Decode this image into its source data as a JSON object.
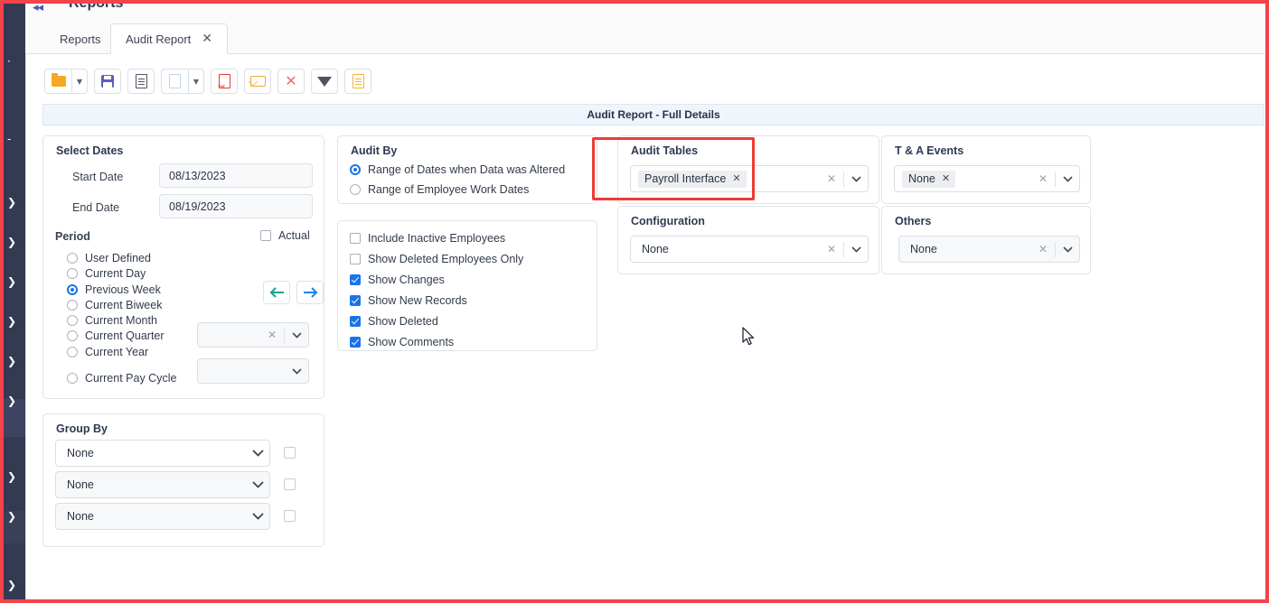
{
  "window": {
    "page_title": "Reports",
    "collapse_icon": "◂◂"
  },
  "tabs": [
    {
      "label": "Reports",
      "active": false
    },
    {
      "label": "Audit Report",
      "active": true,
      "close_icon": "✕"
    }
  ],
  "toolbar": {
    "buttons": [
      {
        "name": "open-folder-button",
        "icon": "folder-icon"
      },
      {
        "name": "open-folder-dropdown",
        "icon": "chevron-down-icon"
      },
      {
        "name": "save-button",
        "icon": "save-icon"
      },
      {
        "name": "report-document-button",
        "icon": "document-icon"
      },
      {
        "name": "new-document-button",
        "icon": "blank-document-icon"
      },
      {
        "name": "new-document-dropdown",
        "icon": "chevron-down-icon"
      },
      {
        "name": "export-pdf-button",
        "icon": "pdf-icon"
      },
      {
        "name": "email-button",
        "icon": "envelope-icon"
      },
      {
        "name": "delete-button",
        "icon": "close-x-icon"
      },
      {
        "name": "filter-button",
        "icon": "funnel-icon"
      },
      {
        "name": "export-document-button",
        "icon": "gold-document-icon"
      }
    ]
  },
  "report_header": {
    "title": "Audit Report - Full Details"
  },
  "select_dates": {
    "title": "Select Dates",
    "start_date_label": "Start Date",
    "start_date_value": "08/13/2023",
    "end_date_label": "End Date",
    "end_date_value": "08/19/2023",
    "period_label": "Period",
    "actual_label": "Actual",
    "actual_checked": false,
    "periods": [
      {
        "label": "User Defined",
        "selected": false
      },
      {
        "label": "Current Day",
        "selected": false
      },
      {
        "label": "Previous Week",
        "selected": true
      },
      {
        "label": "Current Biweek",
        "selected": false
      },
      {
        "label": "Current Month",
        "selected": false
      },
      {
        "label": "Current Quarter",
        "selected": false
      },
      {
        "label": "Current Year",
        "selected": false
      },
      {
        "label": "Current Pay Cycle",
        "selected": false
      }
    ],
    "prev_arrow": "←",
    "next_arrow": "→",
    "quarter_select_value": "",
    "pay_cycle_select_value": ""
  },
  "group_by": {
    "title": "Group By",
    "rows": [
      {
        "value": "None",
        "checked": false
      },
      {
        "value": "None",
        "checked": false
      },
      {
        "value": "None",
        "checked": false
      }
    ]
  },
  "audit_by": {
    "title": "Audit By",
    "options": [
      {
        "label": "Range of Dates when Data was Altered",
        "selected": true
      },
      {
        "label": "Range of Employee Work Dates",
        "selected": false
      }
    ]
  },
  "options": {
    "checkboxes": [
      {
        "label": "Include Inactive Employees",
        "checked": false
      },
      {
        "label": "Show Deleted Employees Only",
        "checked": false
      },
      {
        "label": "Show Changes",
        "checked": true
      },
      {
        "label": "Show New Records",
        "checked": true
      },
      {
        "label": "Show Deleted",
        "checked": true
      },
      {
        "label": "Show Comments",
        "checked": true
      }
    ]
  },
  "audit_tables": {
    "title": "Audit Tables",
    "chip": "Payroll Interface",
    "chip_remove": "✕",
    "clear": "✕",
    "highlighted": true
  },
  "configuration": {
    "title": "Configuration",
    "value": "None",
    "clear": "✕"
  },
  "ta_events": {
    "title": "T & A Events",
    "chip": "None",
    "chip_remove": "✕",
    "clear": "✕"
  },
  "others": {
    "title": "Others",
    "value": "None",
    "clear": "✕"
  },
  "colors": {
    "accent": "#1a73e8",
    "annotation": "#ef3b38",
    "frame": "#f4434a",
    "sidebar": "#343a52",
    "header_bar": "#eff5fd",
    "arrow_prev": "#1aa393",
    "arrow_next": "#1e88e5"
  }
}
